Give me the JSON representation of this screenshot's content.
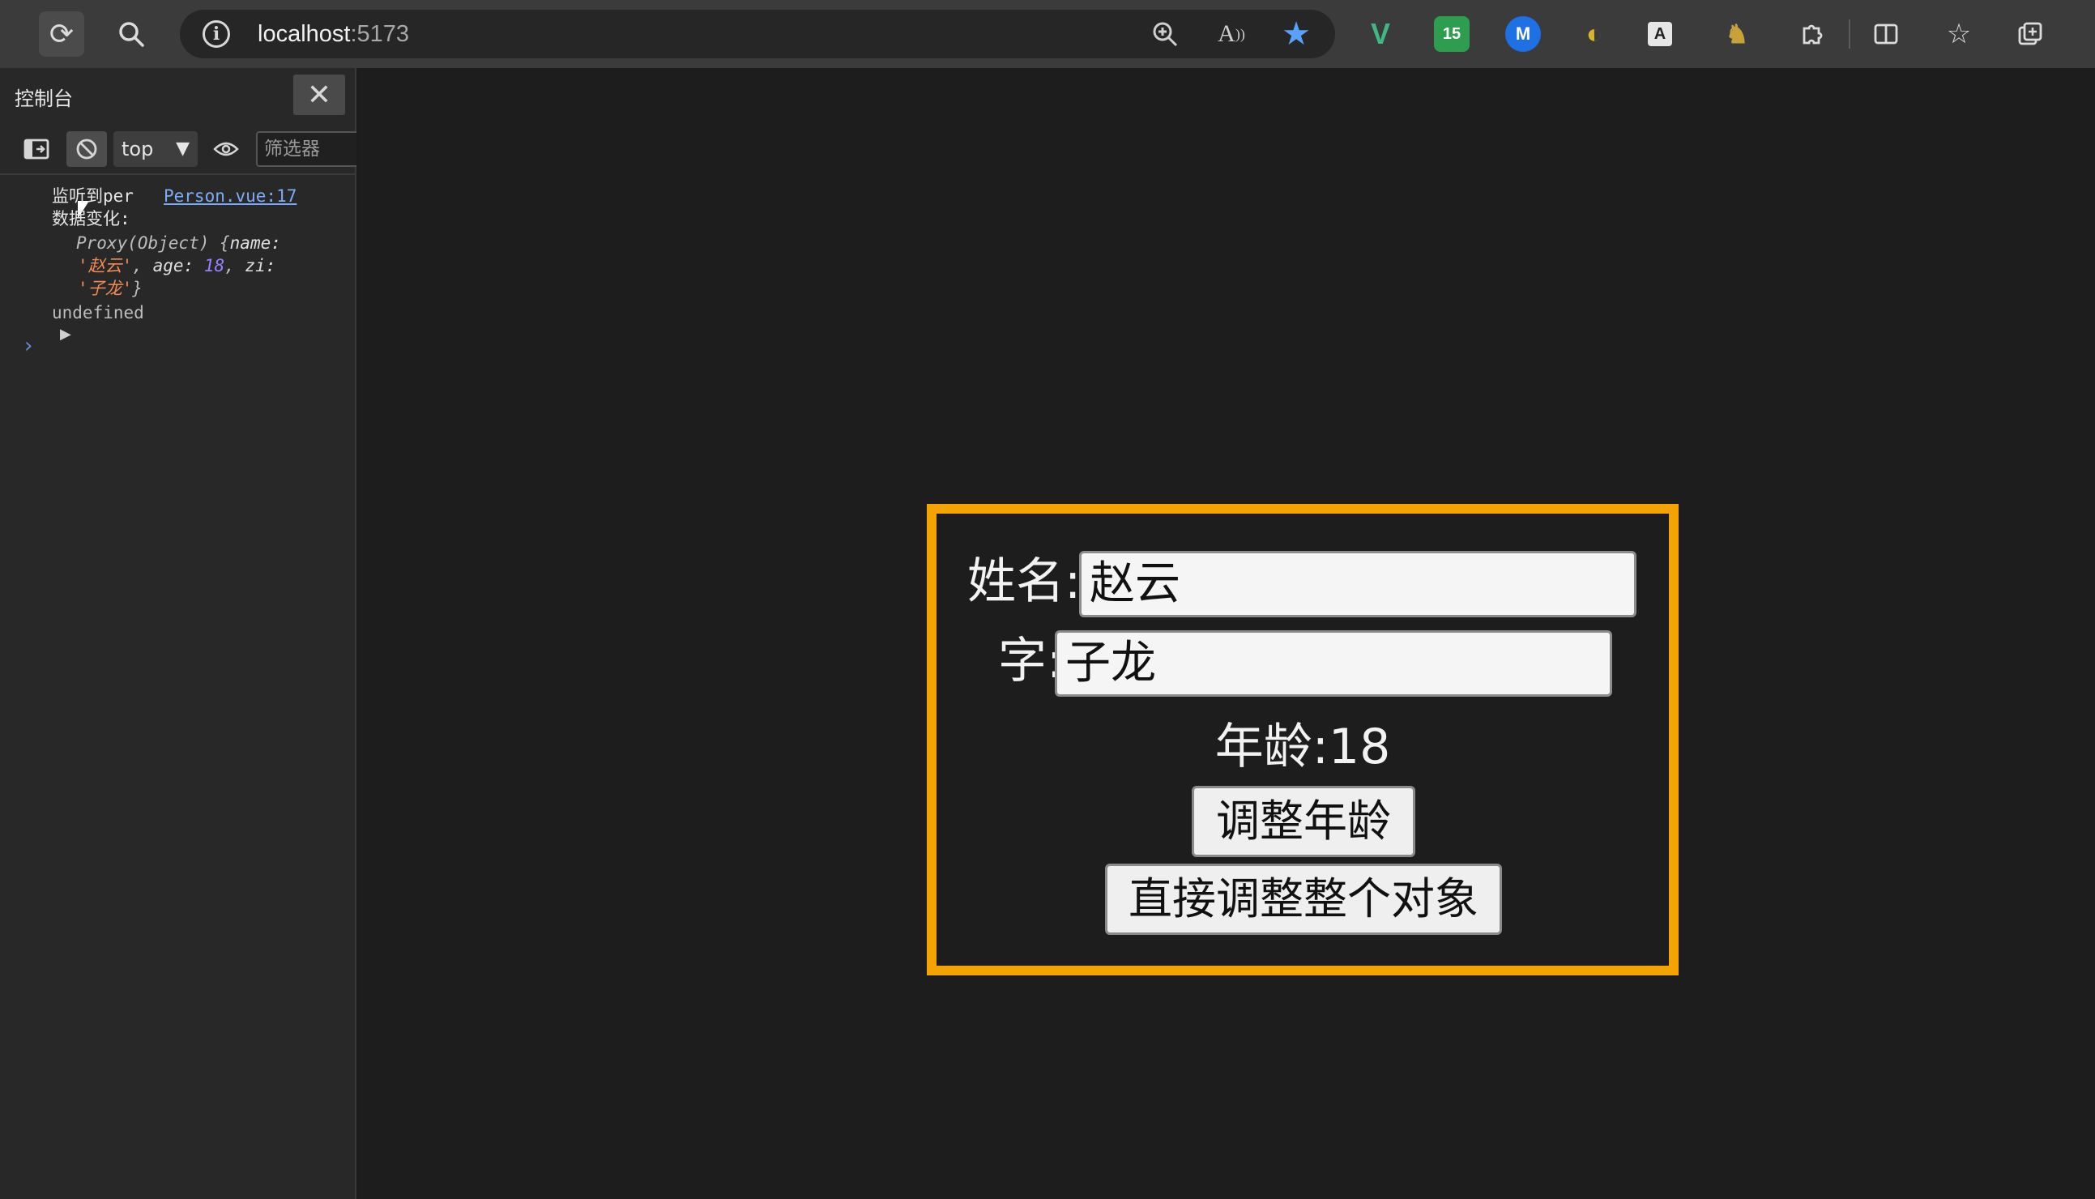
{
  "browser": {
    "host": "localhost",
    "port": ":5173",
    "icons": [
      "reload-icon",
      "search-icon",
      "info-icon",
      "zoom-icon",
      "read-aloud-icon",
      "favorite-star-icon",
      "extensions-icon",
      "split-screen-icon",
      "favorites-icon",
      "collections-icon"
    ],
    "extensions": [
      {
        "name": "vue-devtools-extension",
        "glyph": "V",
        "color": "#41b883"
      },
      {
        "name": "badge-extension",
        "glyph": "15",
        "color": "#2e9d4f"
      },
      {
        "name": "blue-extension",
        "glyph": "M",
        "color": "#1f6fe5"
      },
      {
        "name": "globe-extension",
        "glyph": "◐",
        "color": "#d7b62c"
      },
      {
        "name": "a-extension",
        "glyph": "A",
        "color": "#e6e6e6"
      },
      {
        "name": "mascot-extension",
        "glyph": "♞",
        "color": "#c9a13a"
      }
    ]
  },
  "devtools": {
    "title": "控制台",
    "context": "top",
    "filter_placeholder": "筛选器",
    "log": {
      "line1": "监听到per",
      "source": "Person.vue:17",
      "line2": "数据变化:",
      "proxy_head": "Proxy(Object) {",
      "key_name": "name:",
      "val_name": "'赵云'",
      "sep1": ", ",
      "key_age": "age:",
      "val_age": "18",
      "sep2": ", ",
      "key_zi": "zi:",
      "val_zi": "'子龙'",
      "close": "}",
      "undef": "undefined"
    }
  },
  "app": {
    "name_label": "姓名:",
    "name_value": "赵云",
    "zi_label": "字:",
    "zi_value": "子龙",
    "age_text": "年龄:18",
    "btn_age": "调整年龄",
    "btn_obj": "直接调整整个对象",
    "border_color": "#f5a300"
  }
}
